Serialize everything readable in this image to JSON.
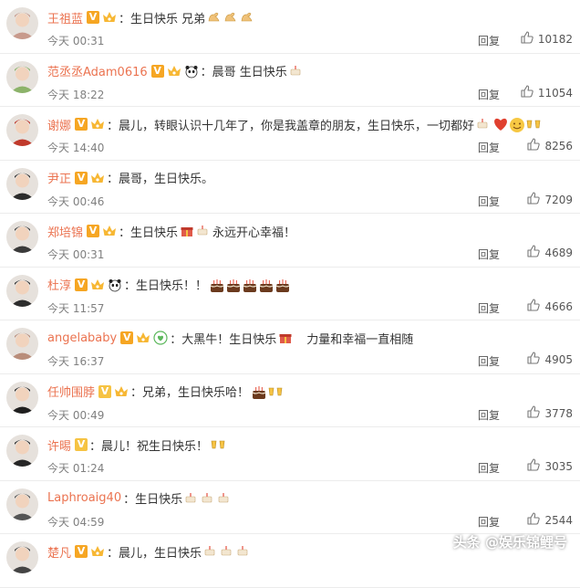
{
  "reply_label": "回复",
  "watermark": "头条 @娱乐锦鲤号",
  "colors": {
    "username": "#eb7350",
    "v_badge": "#f6a623",
    "divider": "#ececec"
  },
  "comments": [
    {
      "user": "王祖蓝",
      "v": true,
      "crown": true,
      "panda": false,
      "heart": false,
      "text": "：生日快乐 兄弟",
      "emojis": [
        "muscle",
        "muscle",
        "muscle"
      ],
      "time": "今天 00:31",
      "likes": "10182"
    },
    {
      "user": "范丞丞Adam0616",
      "v": true,
      "crown": true,
      "panda": true,
      "heart": false,
      "text": "：晨哥 生日快乐",
      "emojis": [
        "cake-small"
      ],
      "time": "今天 18:22",
      "likes": "11054"
    },
    {
      "user": "谢娜",
      "v": true,
      "crown": true,
      "panda": false,
      "heart": false,
      "text": "：晨儿，转眼认识十几年了，你是我盖章的朋友，生日快乐，一切都好",
      "emojis": [
        "cake-small",
        "heart",
        "smile",
        "cheers"
      ],
      "time": "今天 14:40",
      "likes": "8256"
    },
    {
      "user": "尹正",
      "v": true,
      "crown": true,
      "panda": false,
      "heart": false,
      "text": "：晨哥，生日快乐。",
      "emojis": [],
      "time": "今天 00:46",
      "likes": "7209"
    },
    {
      "user": "郑培锦",
      "v": true,
      "crown": true,
      "panda": false,
      "heart": false,
      "text": "：生日快乐",
      "emojis": [
        "gift",
        "cake-small"
      ],
      "text_after": " 永远开心幸福！",
      "time": "今天 00:31",
      "likes": "4689"
    },
    {
      "user": "杜淳",
      "v": true,
      "crown": true,
      "panda": true,
      "heart": false,
      "text": "：生日快乐！！",
      "emojis": [
        "cake",
        "cake",
        "cake",
        "cake",
        "cake"
      ],
      "time": "今天 11:57",
      "likes": "4666"
    },
    {
      "user": "angelababy",
      "v": true,
      "crown": true,
      "panda": false,
      "heart": true,
      "text": "：大黑牛！生日快乐",
      "emojis": [
        "gift"
      ],
      "text_after": "　力量和幸福一直相随",
      "time": "今天 16:37",
      "likes": "4905"
    },
    {
      "user": "任帅围脖",
      "v": true,
      "gold": true,
      "crown": true,
      "panda": false,
      "heart": false,
      "text": "：兄弟，生日快乐哈！",
      "emojis": [
        "cake",
        "cheers"
      ],
      "time": "今天 00:49",
      "likes": "3778"
    },
    {
      "user": "许晹",
      "v": true,
      "gold": true,
      "crown": false,
      "panda": false,
      "heart": false,
      "text": "：晨儿！祝生日快乐！",
      "emojis": [
        "cheers"
      ],
      "time": "今天 01:24",
      "likes": "3035"
    },
    {
      "user": "Laphroaig40",
      "v": false,
      "crown": false,
      "panda": false,
      "heart": false,
      "text": "：生日快乐",
      "emojis": [
        "cake-small",
        "cake-small",
        "cake-small"
      ],
      "time": "今天 04:59",
      "likes": "2544"
    },
    {
      "user": "楚凡",
      "v": true,
      "crown": true,
      "panda": false,
      "heart": false,
      "text": "：晨儿，生日快乐",
      "emojis": [
        "cake-small",
        "cake-small",
        "cake-small"
      ],
      "time": "",
      "likes": ""
    }
  ]
}
